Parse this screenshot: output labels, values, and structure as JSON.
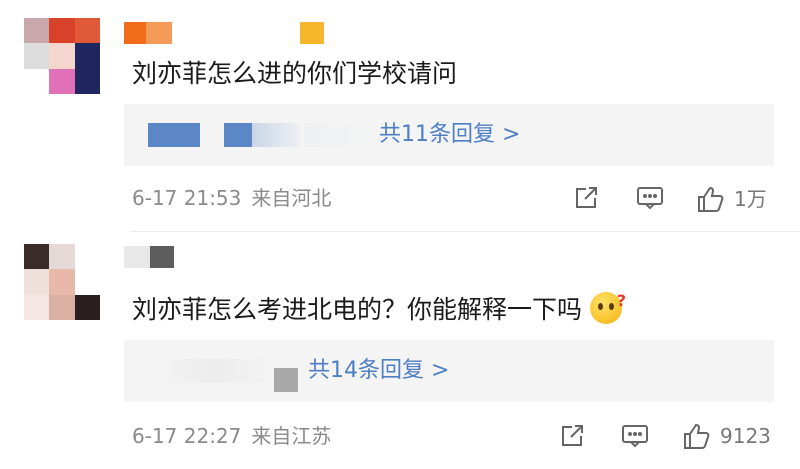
{
  "comments": [
    {
      "text": "刘亦菲怎么进的你们学校请问",
      "replies_label": "共11条回复 >",
      "timestamp": "6-17 21:53",
      "location": "来自河北",
      "like_count": "1万"
    },
    {
      "text": "刘亦菲怎么考进北电的？你能解释一下吗",
      "replies_label": "共14条回复 >",
      "timestamp": "6-17 22:27",
      "location": "来自江苏",
      "like_count": "9123"
    }
  ],
  "icons": {
    "share": "share-icon",
    "comment": "comment-icon",
    "like": "thumbs-up-icon"
  },
  "colors": {
    "link": "#4e7ec4",
    "meta": "#8a8a8a",
    "reply_bg": "#f4f4f4"
  }
}
